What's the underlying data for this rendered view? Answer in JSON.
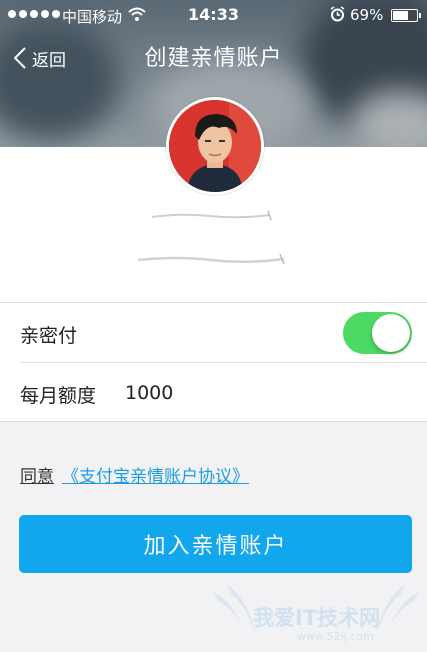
{
  "status_bar": {
    "carrier": "中国移动",
    "time": "14:33",
    "battery_percent": "69%",
    "battery_level": 0.69,
    "icons": [
      "signal-dots-icon",
      "wifi-icon",
      "alarm-icon",
      "battery-icon"
    ]
  },
  "nav": {
    "back_label": "返回",
    "title": "创建亲情账户"
  },
  "settings": {
    "intimate_pay_label": "亲密付",
    "intimate_pay_enabled": true,
    "monthly_quota_label": "每月额度",
    "monthly_quota_value": "1000"
  },
  "agreement": {
    "agree_word": "同意",
    "link_text": "《支付宝亲情账户协议》"
  },
  "join_button_label": "加入亲情账户",
  "watermark": {
    "text": "我爱IT技术网",
    "url": "www.52ij.com"
  },
  "colors": {
    "accent": "#11a7ec",
    "link": "#1b9de0",
    "toggle_on": "#4cd964",
    "page_bg": "#f2f2f4"
  }
}
